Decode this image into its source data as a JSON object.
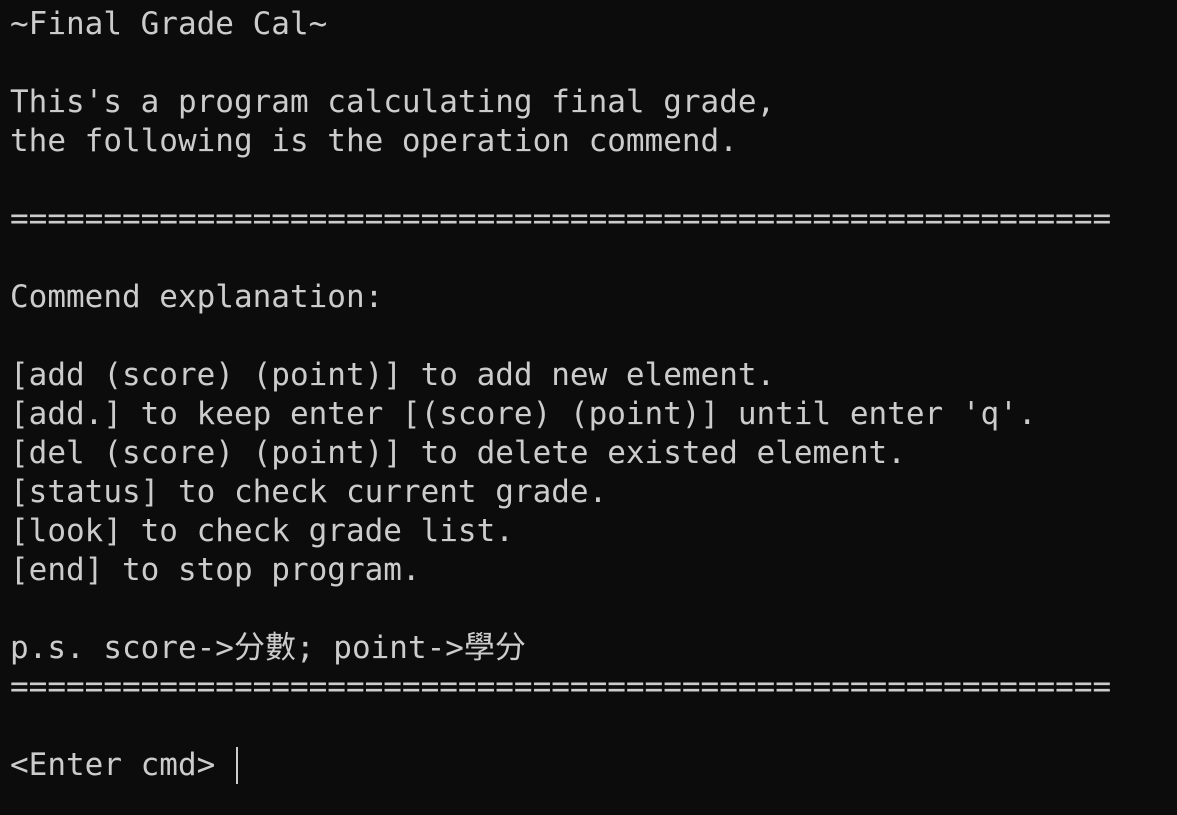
{
  "terminal": {
    "title_line": "~Final Grade Cal~",
    "intro": [
      "This's a program calculating final grade,",
      "the following is the operation commend."
    ],
    "separator": "===========================================================",
    "explanation_header": "Commend explanation:",
    "commands": [
      "[add (score) (point)] to add new element.",
      "[add.] to keep enter [(score) (point)] until enter 'q'.",
      "[del (score) (point)] to delete existed element.",
      "[status] to check current grade.",
      "[look] to check grade list.",
      "[end] to stop program."
    ],
    "note": "p.s. score->分數; point->學分",
    "prompt": "<Enter cmd> ",
    "input_value": ""
  },
  "colors": {
    "background": "#0c0c0c",
    "foreground": "#cccccc"
  }
}
